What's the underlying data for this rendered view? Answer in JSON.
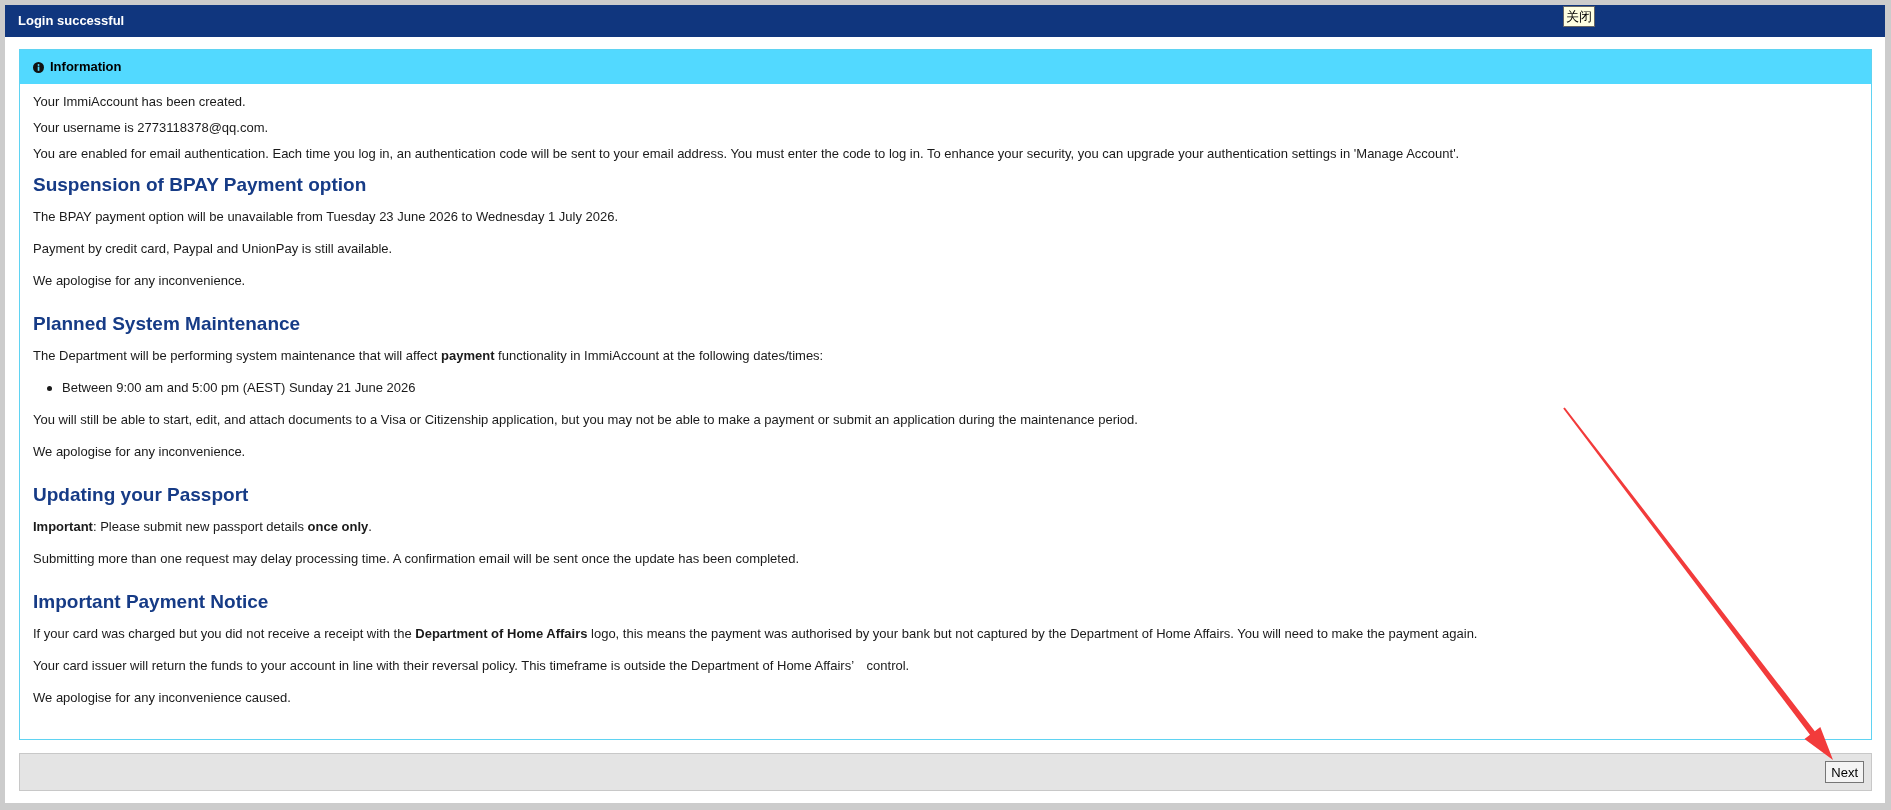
{
  "window": {
    "title": "Login successful",
    "tooltip": "关闭"
  },
  "info_panel": {
    "title": "Information",
    "messages": [
      "Your ImmiAccount has been created.",
      "Your username is 2773118378@qq.com.",
      "You are enabled for email authentication. Each time you log in, an authentication code will be sent to your email address. You must enter the code to log in. To enhance your security, you can upgrade your authentication settings in 'Manage Account'."
    ],
    "sections": [
      {
        "heading": "Suspension of BPAY Payment option",
        "blocks": [
          {
            "kind": "paragraph",
            "text": "The BPAY payment option will be unavailable from Tuesday 23 June 2026 to Wednesday 1 July 2026."
          },
          {
            "kind": "paragraph",
            "text": "Payment by credit card, Paypal and UnionPay is still available."
          },
          {
            "kind": "paragraph",
            "text": "We apologise for any inconvenience."
          }
        ]
      },
      {
        "heading": "Planned System Maintenance",
        "blocks": [
          {
            "kind": "paragraph",
            "text": "The Department will be performing system maintenance that will affect **payment** functionality in ImmiAccount at the following dates/times:"
          },
          {
            "kind": "bullets",
            "items": [
              "Between 9:00 am and 5:00 pm (AEST) Sunday 21 June 2026"
            ]
          },
          {
            "kind": "paragraph",
            "text": "You will still be able to start, edit, and attach documents to a Visa or Citizenship application, but you may not be able to make a payment or submit an application during the maintenance period."
          },
          {
            "kind": "paragraph",
            "text": "We apologise for any inconvenience."
          }
        ]
      },
      {
        "heading": "Updating your Passport",
        "blocks": [
          {
            "kind": "paragraph",
            "text": "**Important**: Please submit new passport details **once only**."
          },
          {
            "kind": "paragraph",
            "text": "Submitting more than one request may delay processing time. A confirmation email will be sent once the update has been completed."
          }
        ]
      },
      {
        "heading": "Important Payment Notice",
        "blocks": [
          {
            "kind": "paragraph",
            "text": "If your card was charged but you did not receive a receipt with the **Department of Home Affairs** logo, this means the payment was authorised by your bank but not captured by the Department of Home Affairs. You will need to make the payment again."
          },
          {
            "kind": "paragraph",
            "text": "Your card issuer will return the funds to your account in line with their reversal policy. This timeframe is outside the Department of Home Affairs’　control."
          },
          {
            "kind": "paragraph",
            "text": "We apologise for any inconvenience caused."
          }
        ]
      }
    ]
  },
  "footer": {
    "buttons": [
      "Next"
    ]
  }
}
